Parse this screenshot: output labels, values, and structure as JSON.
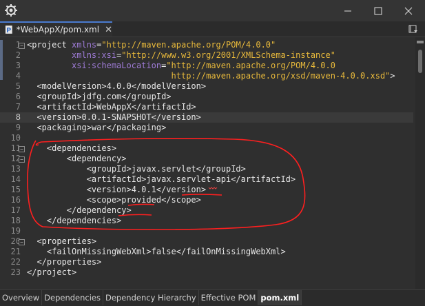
{
  "window": {
    "icon": "eclipse-gear-icon",
    "controls": [
      "minimize-icon",
      "maximize-icon",
      "close-icon"
    ]
  },
  "editor_tab": {
    "label": "*WebAppX/pom.xml",
    "close_glyph": "✕",
    "overflow_glyph": "▾"
  },
  "lines": [
    {
      "n": "1",
      "parts": [
        {
          "t": "<project ",
          "c": "tag"
        },
        {
          "t": "xmlns",
          "c": "attr"
        },
        {
          "t": "=",
          "c": "tag"
        },
        {
          "t": "\"http://maven.apache.org/POM/4.0.0\"",
          "c": "val"
        }
      ]
    },
    {
      "n": "2",
      "parts": [
        {
          "t": "         ",
          "c": "tag"
        },
        {
          "t": "xmlns:xsi",
          "c": "attr"
        },
        {
          "t": "=",
          "c": "tag"
        },
        {
          "t": "\"http://www.w3.org/2001/XMLSchema-instance\"",
          "c": "val"
        }
      ]
    },
    {
      "n": "3",
      "parts": [
        {
          "t": "         ",
          "c": "tag"
        },
        {
          "t": "xsi:schemaLocation",
          "c": "attr"
        },
        {
          "t": "=",
          "c": "tag"
        },
        {
          "t": "\"http://maven.apache.org/POM/4.0.0",
          "c": "val"
        }
      ]
    },
    {
      "n": "4",
      "parts": [
        {
          "t": "                             ",
          "c": "tag"
        },
        {
          "t": "http://maven.apache.org/xsd/maven-4.0.0.xsd\"",
          "c": "val"
        },
        {
          "t": ">",
          "c": "tag"
        }
      ]
    },
    {
      "n": "5",
      "parts": [
        {
          "t": "  <modelVersion>4.0.0</modelVersion>",
          "c": "tag"
        }
      ]
    },
    {
      "n": "6",
      "parts": [
        {
          "t": "  <groupId>jdfg.com</groupId>",
          "c": "tag"
        }
      ]
    },
    {
      "n": "7",
      "parts": [
        {
          "t": "  <artifactId>WebAppX</artifactId>",
          "c": "tag"
        }
      ]
    },
    {
      "n": "8",
      "parts": [
        {
          "t": "  <version>0.0.1-SNAPSHOT</version>",
          "c": "tag"
        }
      ],
      "current": true
    },
    {
      "n": "9",
      "parts": [
        {
          "t": "  <packaging>war</packaging>",
          "c": "tag"
        }
      ]
    },
    {
      "n": "10",
      "parts": [
        {
          "t": "",
          "c": "tag"
        }
      ]
    },
    {
      "n": "11",
      "parts": [
        {
          "t": "    <dependencies>",
          "c": "tag"
        }
      ]
    },
    {
      "n": "12",
      "parts": [
        {
          "t": "        <dependency>",
          "c": "tag"
        }
      ]
    },
    {
      "n": "13",
      "parts": [
        {
          "t": "            <groupId>javax.servlet</groupId>",
          "c": "tag"
        }
      ]
    },
    {
      "n": "14",
      "parts": [
        {
          "t": "            <artifactId>javax.servlet-api</artifactId>",
          "c": "tag"
        }
      ]
    },
    {
      "n": "15",
      "parts": [
        {
          "t": "            <version>4.0.1</version>",
          "c": "tag"
        }
      ]
    },
    {
      "n": "16",
      "parts": [
        {
          "t": "            <scope>provided</scope>",
          "c": "tag"
        }
      ]
    },
    {
      "n": "17",
      "parts": [
        {
          "t": "        </dependency>",
          "c": "tag"
        }
      ]
    },
    {
      "n": "18",
      "parts": [
        {
          "t": "    </dependencies>",
          "c": "tag"
        }
      ]
    },
    {
      "n": "19",
      "parts": [
        {
          "t": "",
          "c": "tag"
        }
      ]
    },
    {
      "n": "20",
      "parts": [
        {
          "t": "  <properties>",
          "c": "tag"
        }
      ]
    },
    {
      "n": "21",
      "parts": [
        {
          "t": "    <failOnMissingWebXml>false</failOnMissingWebXml>",
          "c": "tag"
        }
      ]
    },
    {
      "n": "22",
      "parts": [
        {
          "t": "  </properties>",
          "c": "tag"
        }
      ]
    },
    {
      "n": "23",
      "parts": [
        {
          "t": "</project>",
          "c": "tag"
        }
      ]
    }
  ],
  "bottom_tabs": [
    {
      "label": "Overview",
      "active": false
    },
    {
      "label": "Dependencies",
      "active": false
    },
    {
      "label": "Dependency Hierarchy",
      "active": false
    },
    {
      "label": "Effective POM",
      "active": false
    },
    {
      "label": "pom.xml",
      "active": true
    }
  ],
  "colors": {
    "background": "#2f2f2f",
    "tag_text": "#e6e6e6",
    "attribute": "#9e7bd6",
    "attribute_value": "#e8b93b",
    "annotation_red": "#ff1f1f",
    "tab_accent": "#4a7bd0"
  }
}
